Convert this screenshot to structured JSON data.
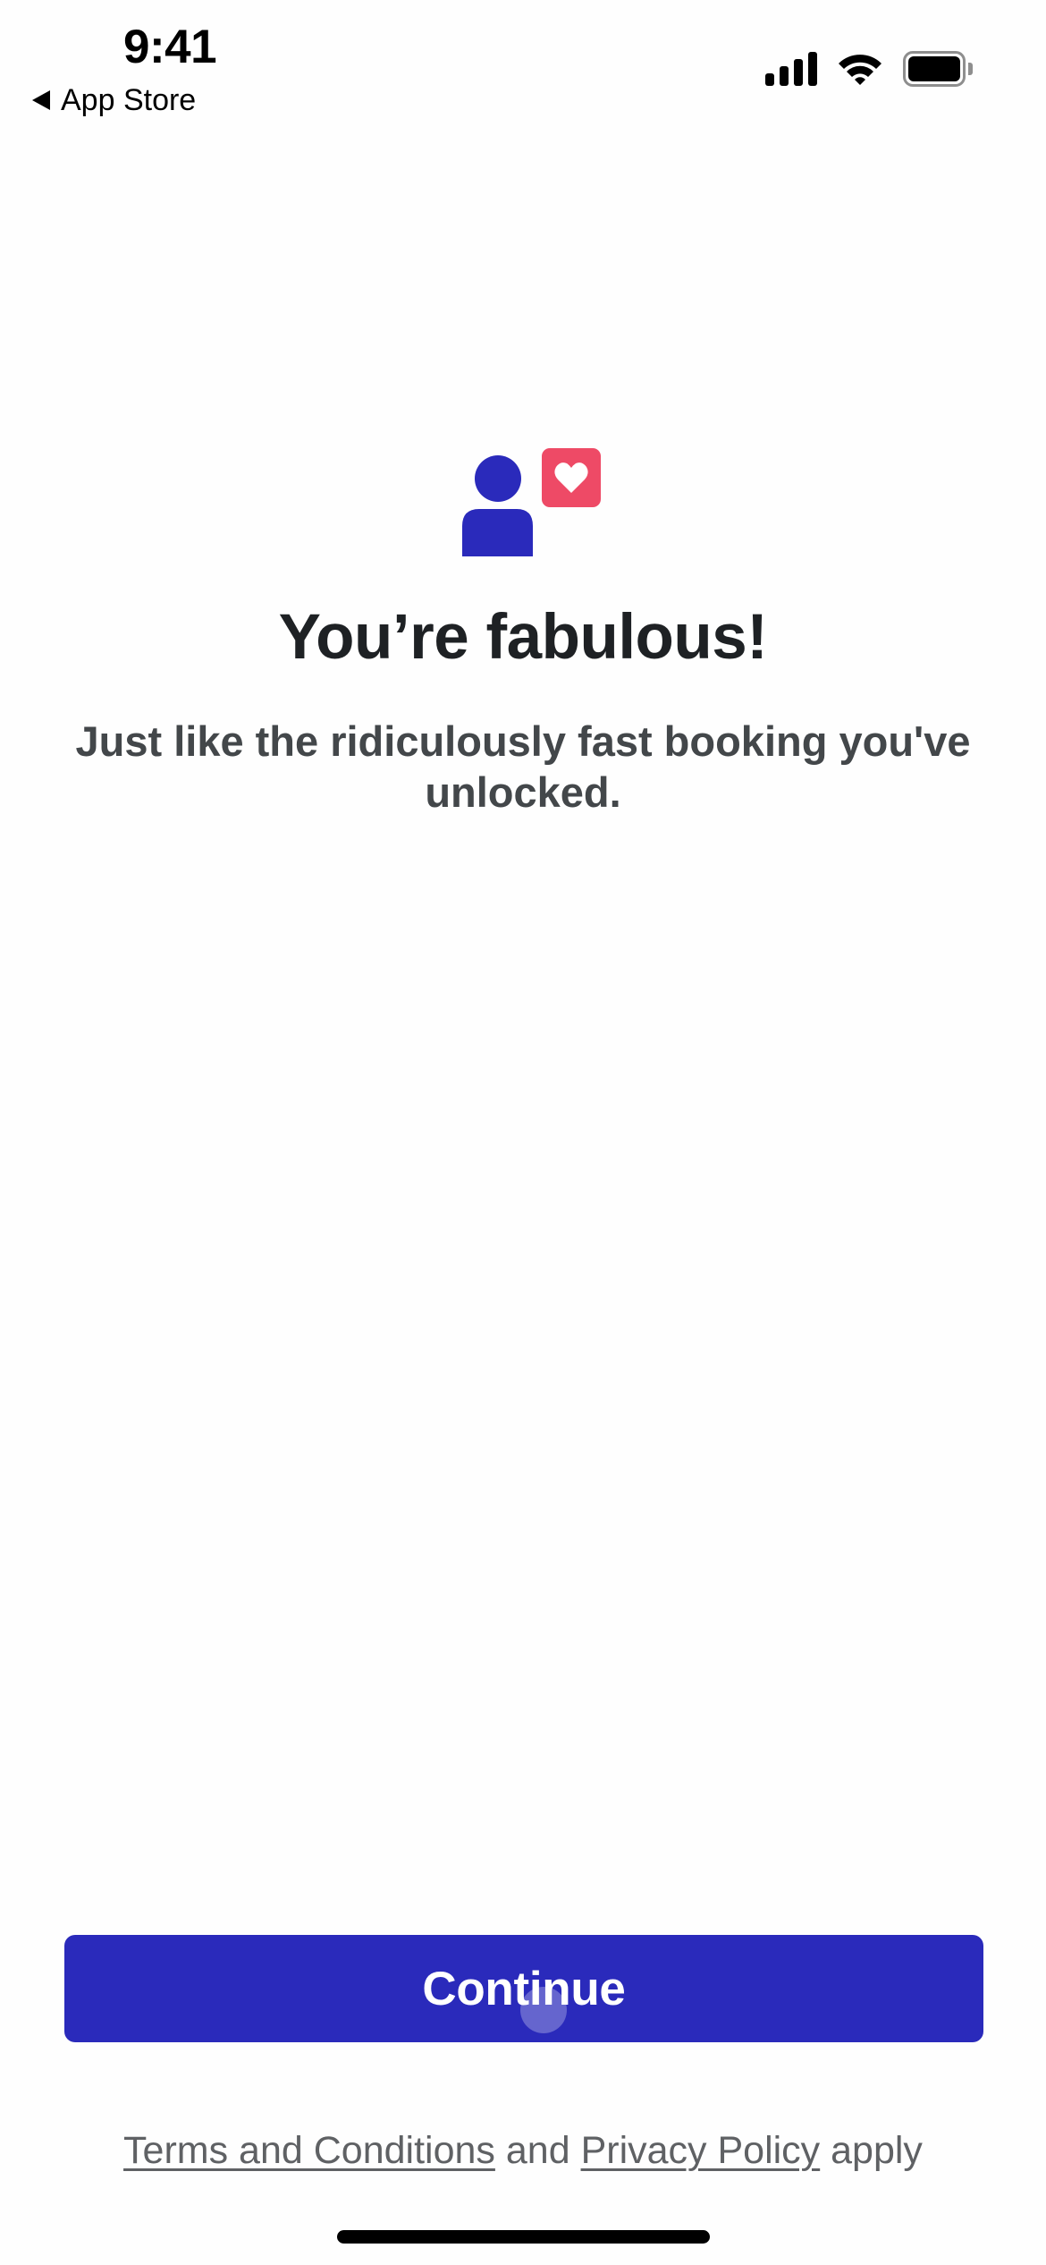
{
  "status_bar": {
    "time": "9:41",
    "back_label": "App Store",
    "icons": [
      "signal-icon",
      "wifi-icon",
      "battery-icon"
    ]
  },
  "main": {
    "illustration": {
      "icon": "person-with-heart-icon",
      "person_color": "#2A2ABB",
      "badge_color": "#EE4A66"
    },
    "title": "You’re fabulous!",
    "subtitle": "Just like the ridiculously fast booking you've unlocked."
  },
  "actions": {
    "continue_label": "Continue",
    "button_color": "#2A2ABB"
  },
  "footer": {
    "terms_label": "Terms and Conditions",
    "and_label": " and ",
    "privacy_label": "Privacy Policy",
    "apply_label": " apply"
  }
}
